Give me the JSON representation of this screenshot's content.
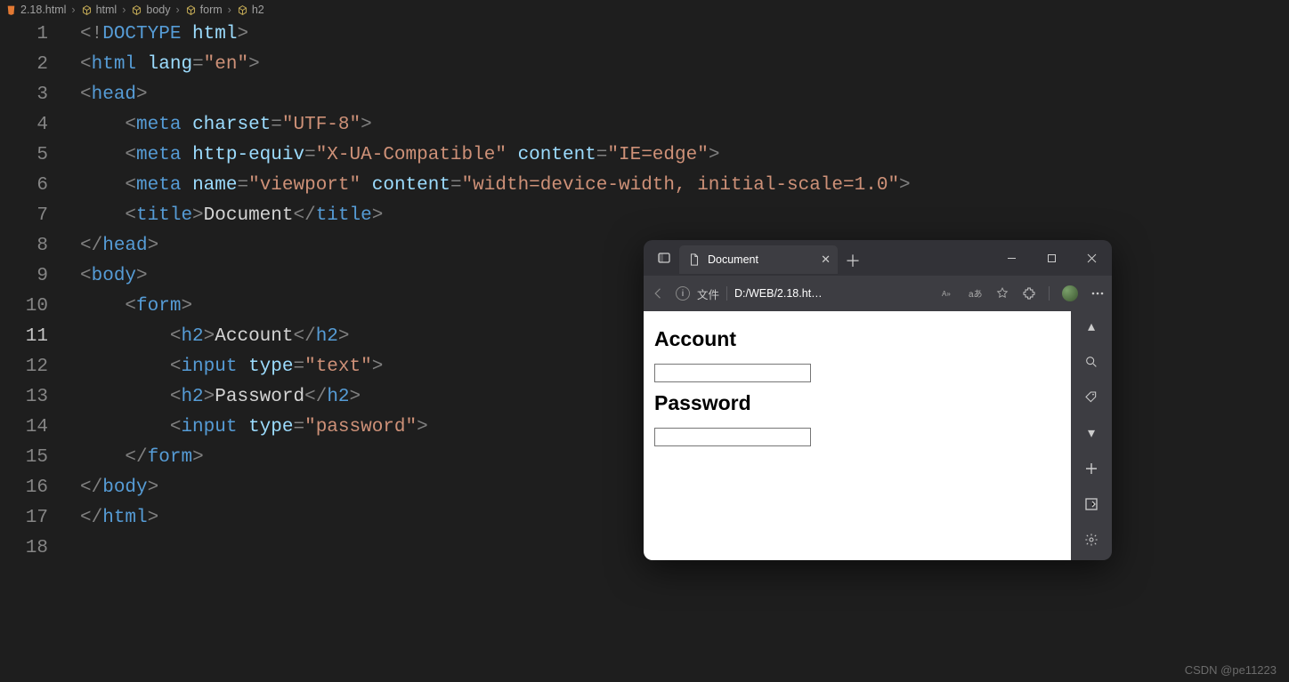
{
  "breadcrumbs": {
    "file": "2.18.html",
    "path1": "html",
    "path2": "body",
    "path3": "form",
    "path4": "h2"
  },
  "lines": [
    "1",
    "2",
    "3",
    "4",
    "5",
    "6",
    "7",
    "8",
    "9",
    "10",
    "11",
    "12",
    "13",
    "14",
    "15",
    "16",
    "17",
    "18"
  ],
  "activeLine": "11",
  "code": {
    "l1": {
      "pre": "",
      "body": "<span class='p'>&lt;!</span><span class='tag'>DOCTYPE</span> <span class='attr'>html</span><span class='p'>&gt;</span>"
    },
    "l2": {
      "pre": "",
      "body": "<span class='p'>&lt;</span><span class='tag'>html</span> <span class='attr'>lang</span><span class='p'>=</span><span class='str'>\"en\"</span><span class='p'>&gt;</span>"
    },
    "l3": {
      "pre": "",
      "body": "<span class='p'>&lt;</span><span class='tag'>head</span><span class='p'>&gt;</span>"
    },
    "l4": {
      "pre": "    ",
      "body": "<span class='p'>&lt;</span><span class='tag'>meta</span> <span class='attr'>charset</span><span class='p'>=</span><span class='str'>\"UTF-8\"</span><span class='p'>&gt;</span>"
    },
    "l5": {
      "pre": "    ",
      "body": "<span class='p'>&lt;</span><span class='tag'>meta</span> <span class='attr'>http-equiv</span><span class='p'>=</span><span class='str'>\"X-UA-Compatible\"</span> <span class='attr'>content</span><span class='p'>=</span><span class='str'>\"IE=edge\"</span><span class='p'>&gt;</span>"
    },
    "l6": {
      "pre": "    ",
      "body": "<span class='p'>&lt;</span><span class='tag'>meta</span> <span class='attr'>name</span><span class='p'>=</span><span class='str'>\"viewport\"</span> <span class='attr'>content</span><span class='p'>=</span><span class='str'>\"width=device-width, initial-scale=1.0\"</span><span class='p'>&gt;</span>"
    },
    "l7": {
      "pre": "    ",
      "body": "<span class='p'>&lt;</span><span class='tag'>title</span><span class='p'>&gt;</span><span class='txt'>Document</span><span class='p'>&lt;/</span><span class='tag'>title</span><span class='p'>&gt;</span>"
    },
    "l8": {
      "pre": "",
      "body": "<span class='p'>&lt;/</span><span class='tag'>head</span><span class='p'>&gt;</span>"
    },
    "l9": {
      "pre": "",
      "body": "<span class='p'>&lt;</span><span class='tag'>body</span><span class='p'>&gt;</span>"
    },
    "l10": {
      "pre": "    ",
      "body": "<span class='p'>&lt;</span><span class='tag'>form</span><span class='p'>&gt;</span>"
    },
    "l11": {
      "pre": "        ",
      "body": "<span class='p'>&lt;</span><span class='tag'>h2</span><span class='p'>&gt;</span><span class='txt'>Account</span><span class='p'>&lt;/</span><span class='tag'>h2</span><span class='p'>&gt;</span>"
    },
    "l12": {
      "pre": "        ",
      "body": "<span class='p'>&lt;</span><span class='tag'>input</span> <span class='attr'>type</span><span class='p'>=</span><span class='str'>\"text\"</span><span class='p'>&gt;</span>"
    },
    "l13": {
      "pre": "        ",
      "body": "<span class='p'>&lt;</span><span class='tag'>h2</span><span class='p'>&gt;</span><span class='txt'>Password</span><span class='p'>&lt;/</span><span class='tag'>h2</span><span class='p'>&gt;</span>"
    },
    "l14": {
      "pre": "        ",
      "body": "<span class='p'>&lt;</span><span class='tag'>input</span> <span class='attr'>type</span><span class='p'>=</span><span class='str'>\"password\"</span><span class='p'>&gt;</span>"
    },
    "l15": {
      "pre": "    ",
      "body": "<span class='p'>&lt;/</span><span class='tag'>form</span><span class='p'>&gt;</span>"
    },
    "l16": {
      "pre": "",
      "body": "<span class='p'>&lt;/</span><span class='tag'>body</span><span class='p'>&gt;</span>"
    },
    "l17": {
      "pre": "",
      "body": "<span class='p'>&lt;/</span><span class='tag'>html</span><span class='p'>&gt;</span>"
    },
    "l18": {
      "pre": "",
      "body": ""
    }
  },
  "browser": {
    "tabTitle": "Document",
    "addrLabel": "文件",
    "addrPath": "D:/WEB/2.18.ht…",
    "page": {
      "h2a": "Account",
      "h2b": "Password"
    }
  },
  "watermark": "CSDN @pe11223"
}
